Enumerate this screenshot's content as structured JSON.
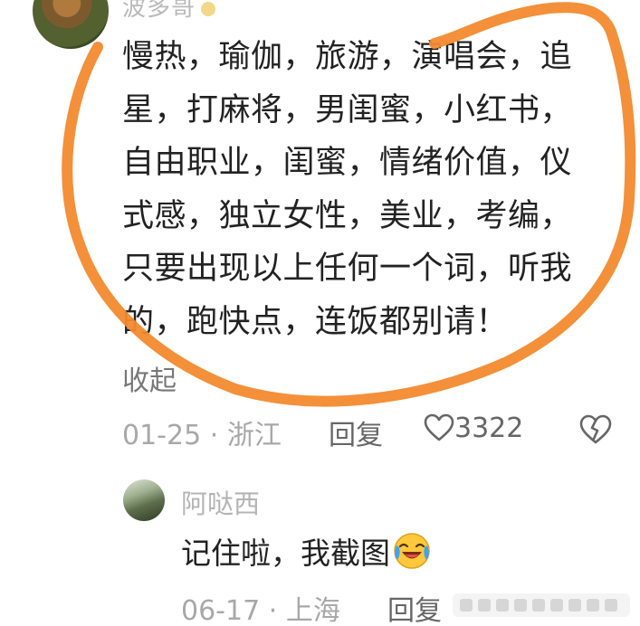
{
  "comment": {
    "username": "波多哥",
    "badge_icon": "badge-icon",
    "body_lines": [
      "慢热，瑜伽，旅游，演唱会，追",
      "星，打麻将，男闺蜜，小红书，",
      "自由职业，闺蜜，情绪价值，仪",
      "式感，独立女性，美业，考编，",
      "只要出现以上任何一个词，听我",
      "的，跑快点，连饭都别请！"
    ],
    "collapse_label": "收起",
    "date": "01-25",
    "separator": "·",
    "location": "浙江",
    "reply_label": "回复",
    "like_count": "3322",
    "like_icon": "heart-outline-icon",
    "dislike_icon": "broken-heart-icon"
  },
  "reply": {
    "username": "阿哒西",
    "body": "记住啦，我截图",
    "emoji": "laughing-crying-emoji",
    "date": "06-17",
    "separator": "·",
    "location": "上海",
    "reply_label": "回复"
  },
  "annotation": {
    "color": "#f28a2e",
    "shape": "hand-drawn-circle"
  }
}
